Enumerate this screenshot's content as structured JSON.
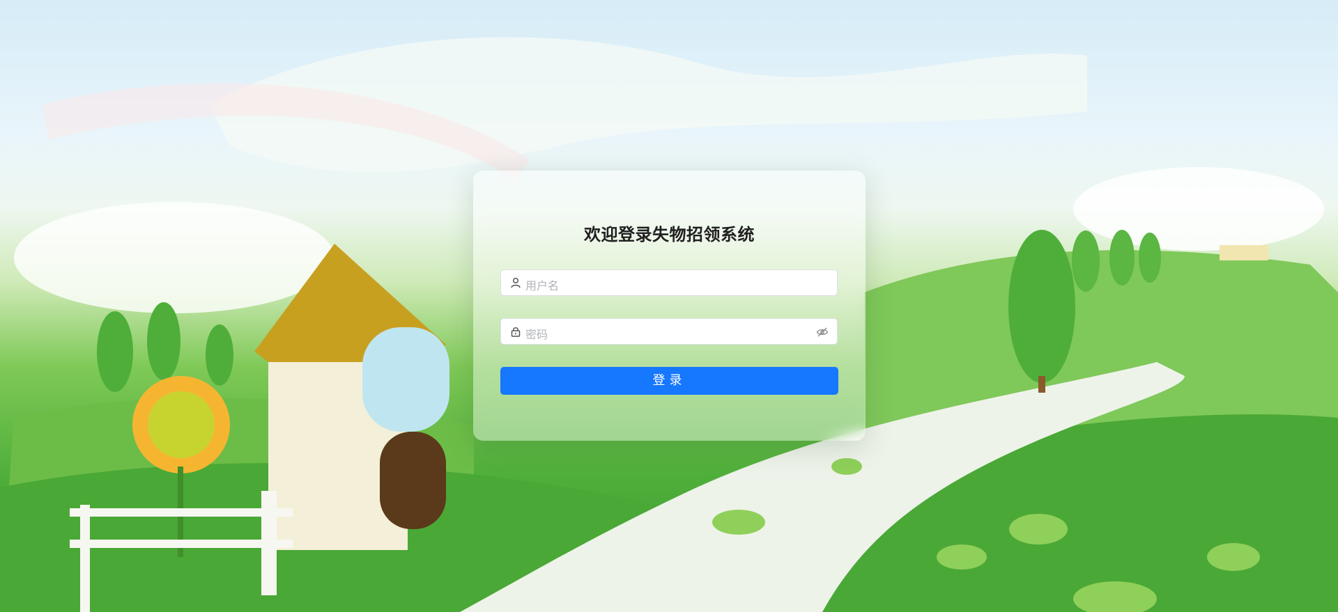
{
  "login": {
    "title": "欢迎登录失物招领系统",
    "username_placeholder": "用户名",
    "password_placeholder": "密码",
    "submit_label": "登录"
  },
  "icons": {
    "username": "user-icon",
    "password": "lock-icon",
    "toggle_password": "eye-off-icon"
  },
  "colors": {
    "primary": "#1677ff"
  }
}
